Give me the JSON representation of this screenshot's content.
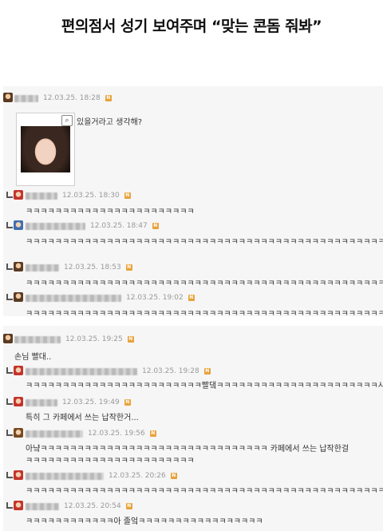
{
  "headline": "편의점서 성기 보여주며 “맞는 콘돔 줘봐”",
  "thread1": {
    "post": {
      "time": "12.03.25. 18:28",
      "badge": "N",
      "text": "있을거라고 생각해?"
    },
    "replies": [
      {
        "time": "12.03.25. 18:30",
        "badge": "N",
        "text": "ㅋㅋㅋㅋㅋㅋㅋㅋㅋㅋㅋㅋㅋㅋㅋㅋㅋㅋㅋㅋㅋㅋㅋ"
      },
      {
        "time": "12.03.25. 18:47",
        "badge": "N",
        "text": "ㅋㅋㅋㅋㅋㅋㅋㅋㅋㅋㅋㅋㅋㅋㅋㅋㅋㅋㅋㅋㅋㅋㅋㅋㅋㅋㅋㅋㅋㅋㅋㅋㅋㅋㅋㅋㅋㅋㅋㅋㅋㅋㅋㅋㅋㅋㅋㅋㅋ표정봐ㅋ"
      },
      {
        "time": "12.03.25. 18:53",
        "badge": "N",
        "text": "ㅋㅋㅋㅋㅋㅋㅋㅋㅋㅋㅋㅋㅋㅋㅋㅋㅋㅋㅋㅋㅋㅋㅋㅋㅋㅋㅋㅋㅋㅋㅋㅋㅋㅋㅋㅋㅋㅋㅋㅋㅋㅋㅋㅋㅋㅋㅋㅋㅋㅋㅋ"
      },
      {
        "time": "12.03.25. 19:02",
        "badge": "N",
        "text": "ㅋㅋㅋㅋㅋㅋㅋㅋㅋㅋㅋㅋㅋㅋㅋㅋㅋㅋㅋㅋㅋㅋㅋㅋㅋㅋㅋㅋㅋㅋㅋㅋㅋㅋㅋㅋㅋㅋㅋㅋㅋㅋㅋㅋㅋㅋㅋㅋㅋㅋ"
      }
    ]
  },
  "thread2": {
    "post": {
      "time": "12.03.25. 19:25",
      "badge": "N",
      "text": "손님 빨대.."
    },
    "replies": [
      {
        "time": "12.03.25. 19:28",
        "badge": "N",
        "text": "ㅋㅋㅋㅋㅋㅋㅋㅋㅋㅋㅋㅋㅋㅋㅋㅋㅋㅋㅋㅋㅋㅋㅋㅋ빨댘ㅋㅋㅋㅋㅋㅋㅋㅋㅋㅋㅋㅋㅋㅋㅋㅋㅋㅋㅋㅋㅋㅋ시발ㅋㅋㅋㅋ"
      },
      {
        "time": "12.03.25. 19:49",
        "badge": "N",
        "text": "특히 그 카페에서 쓰는 납작한거..."
      },
      {
        "time": "12.03.25. 19:56",
        "badge": "N",
        "text": "아냨ㅋㅋㅋㅋㅋㅋㅋㅋㅋㅋㅋㅋㅋㅋㅋㅋㅋㅋㅋㅋㅋㅋㅋㅋㅋㅋㅋㅋㅋㅋㅋ 카페에서 쓰는 납작한걸",
        "text2": "ㅋㅋㅋㅋㅋㅋㅋㅋㅋㅋㅋㅋㅋㅋㅋㅋㅋㅋㅋㅋㅋㅋㅋ"
      },
      {
        "time": "12.03.25. 20:26",
        "badge": "N",
        "text": "ㅋㅋㅋㅋㅋㅋㅋㅋㅋㅋㅋㅋㅋㅋㅋㅋㅋㅋㅋㅋㅋㅋㅋㅋㅋㅋㅋㅋㅋㅋㅋㅋㅋㅋㅋㅋㅋㅋㅋㅋㅋㅋㅋㅋㅋㅋㅋㅋㅋ"
      },
      {
        "time": "12.03.25. 20:54",
        "badge": "N",
        "text": "ㅋㅋㅋㅋㅋㅋㅋㅋㅋㅋㅋㅋ아 졸엌ㅋㅋㅋㅋㅋㅋㅋㅋㅋㅋㅋㅋㅋㅋㅋㅋㅋ"
      }
    ]
  }
}
